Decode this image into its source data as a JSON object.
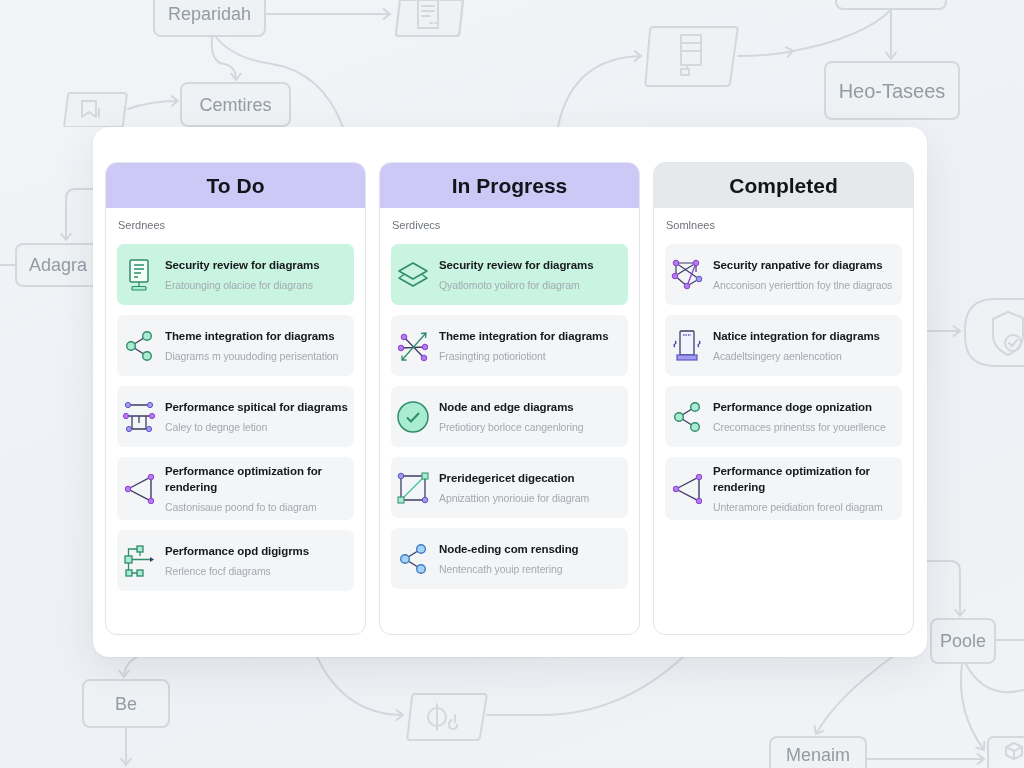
{
  "background_diagram": {
    "nodes": [
      {
        "label": "Reparidah"
      },
      {
        "label": "Cemtires"
      },
      {
        "label": "Heo-Tasees"
      },
      {
        "label": "Adagra"
      },
      {
        "label": "Poole"
      },
      {
        "label": "Be"
      },
      {
        "label": "Menaim"
      }
    ]
  },
  "board": {
    "columns": [
      {
        "title": "To Do",
        "color": "#cdc8f6",
        "subtitle": "Serdnees",
        "cards": [
          {
            "title": "Security review for diagrams",
            "description": "Eratounging olacioe for diagrans",
            "selected": true
          },
          {
            "title": "Theme integration for diagrams",
            "description": "Diagrams m youudoding perisentation",
            "selected": false
          },
          {
            "title": "Performance spitical for diagrams",
            "description": "Caley to degnge letion",
            "selected": false
          },
          {
            "title": "Performance optimization for rendering",
            "description": "Castonisaue poond fo to diagram",
            "selected": false
          },
          {
            "title": "Performance opd digigrms",
            "description": "Rerlence focf diagrams",
            "selected": false
          }
        ]
      },
      {
        "title": "In Progress",
        "color": "#cdc8f6",
        "subtitle": "Serdivecs",
        "cards": [
          {
            "title": "Security review for diagrams",
            "description": "Qyatlomoto yoiloro for diagram",
            "selected": true
          },
          {
            "title": "Theme integration for diagrams",
            "description": "Frasingting potioriotiont",
            "selected": false
          },
          {
            "title": "Node and edge diagrams",
            "description": "Pretiotiory borloce cangenloring",
            "selected": false
          },
          {
            "title": "Preridegericet digecation",
            "description": "Apnizattion ynoriouie for diagram",
            "selected": false
          },
          {
            "title": "Node-eding com rensding",
            "description": "Nentencath youip rentering",
            "selected": false
          }
        ]
      },
      {
        "title": "Completed",
        "color": "#e6e9ec",
        "subtitle": "Somlnees",
        "cards": [
          {
            "title": "Security ranpative for diagrams",
            "description": "Ancconison yerierttion foy tlne diagraos",
            "selected": false
          },
          {
            "title": "Natice integration for diagrams",
            "description": "Acadeltsingery aenlencotion",
            "selected": false
          },
          {
            "title": "Performance doge opnization",
            "description": "Crecomaces prinentss for youerllence",
            "selected": false
          },
          {
            "title": "Performance optimization for rendering",
            "description": "Unteramore peidiation foreol diagram",
            "selected": false
          }
        ]
      }
    ]
  }
}
